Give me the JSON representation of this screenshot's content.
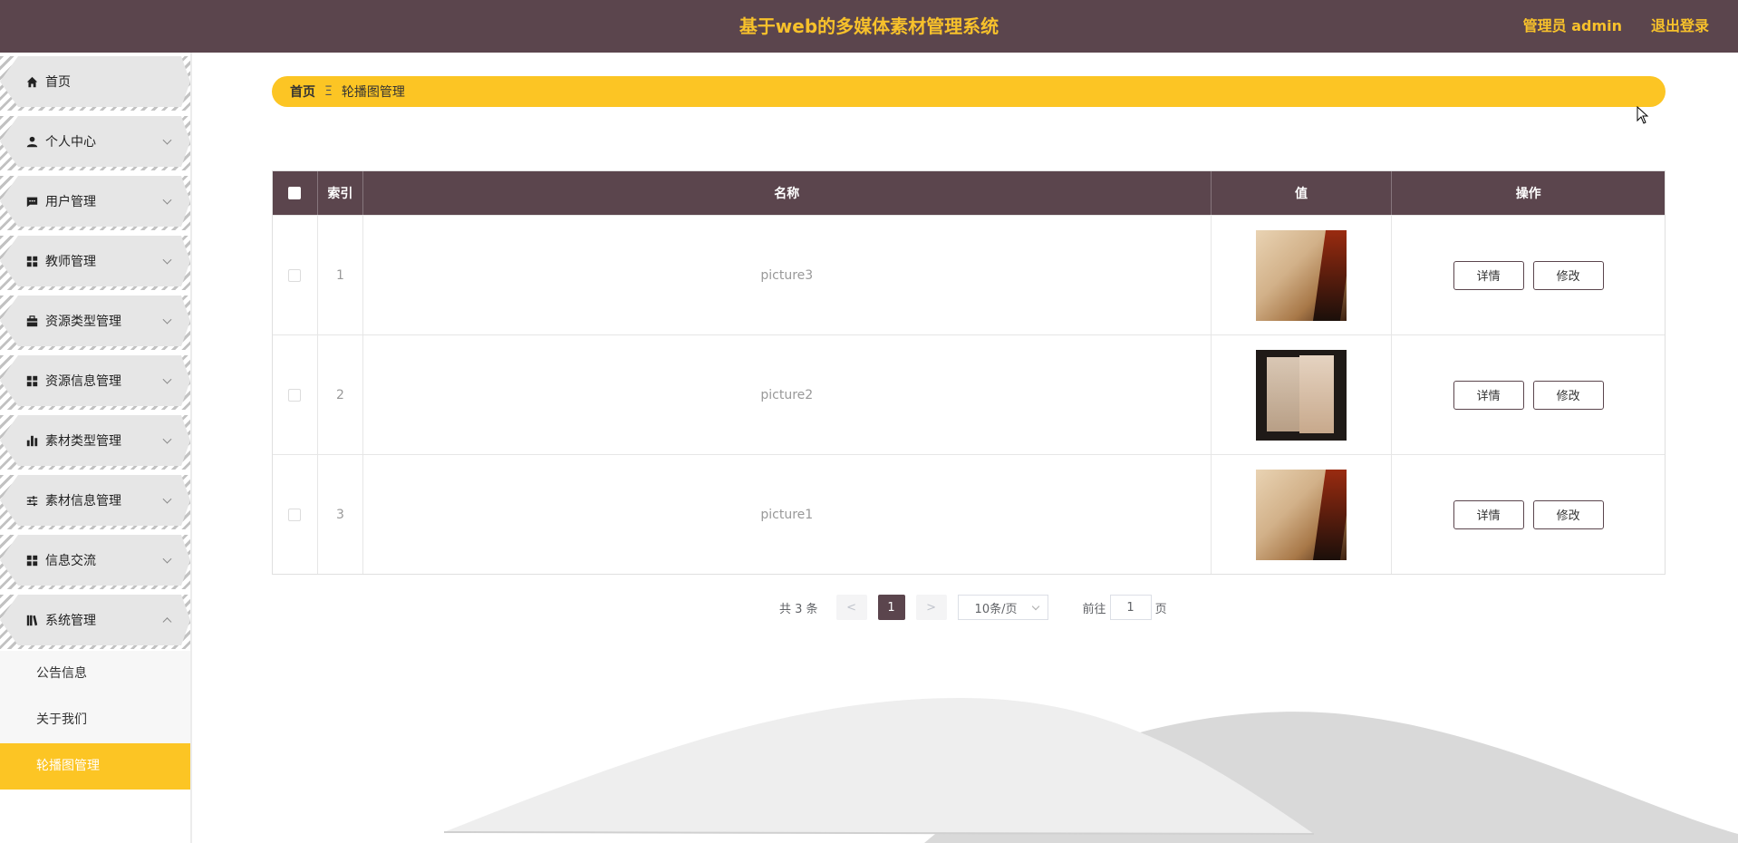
{
  "header": {
    "title": "基于web的多媒体素材管理系统",
    "admin": "管理员 admin",
    "logout": "退出登录"
  },
  "sidebar": {
    "items": [
      {
        "label": "首页",
        "icon": "home-icon"
      },
      {
        "label": "个人中心",
        "icon": "user-icon"
      },
      {
        "label": "用户管理",
        "icon": "chat-icon"
      },
      {
        "label": "教师管理",
        "icon": "grid-icon"
      },
      {
        "label": "资源类型管理",
        "icon": "briefcase-icon"
      },
      {
        "label": "资源信息管理",
        "icon": "grid-icon"
      },
      {
        "label": "素材类型管理",
        "icon": "bar-chart-icon"
      },
      {
        "label": "素材信息管理",
        "icon": "sliders-icon"
      },
      {
        "label": "信息交流",
        "icon": "grid-icon"
      },
      {
        "label": "系统管理",
        "icon": "book-icon"
      }
    ],
    "submenu": [
      "公告信息",
      "关于我们",
      "轮播图管理"
    ]
  },
  "breadcrumb": {
    "home": "首页",
    "separator": "Ξ",
    "current": "轮播图管理"
  },
  "table": {
    "headers": [
      "索引",
      "名称",
      "值",
      "操作"
    ],
    "rows": [
      {
        "index": "1",
        "name": "picture3",
        "thumb": "warm"
      },
      {
        "index": "2",
        "name": "picture2",
        "thumb": "dark"
      },
      {
        "index": "3",
        "name": "picture1",
        "thumb": "warm"
      }
    ],
    "detail_label": "详情",
    "edit_label": "修改"
  },
  "pagination": {
    "total": "共 3 条",
    "prev": "<",
    "current_page": "1",
    "next": ">",
    "page_size": "10条/页",
    "goto_label": "前往",
    "goto_value": "1",
    "page_unit": "页"
  },
  "colors": {
    "header_bg": "#5b454d",
    "accent": "#fcc524",
    "title_text": "#f7c12b"
  }
}
